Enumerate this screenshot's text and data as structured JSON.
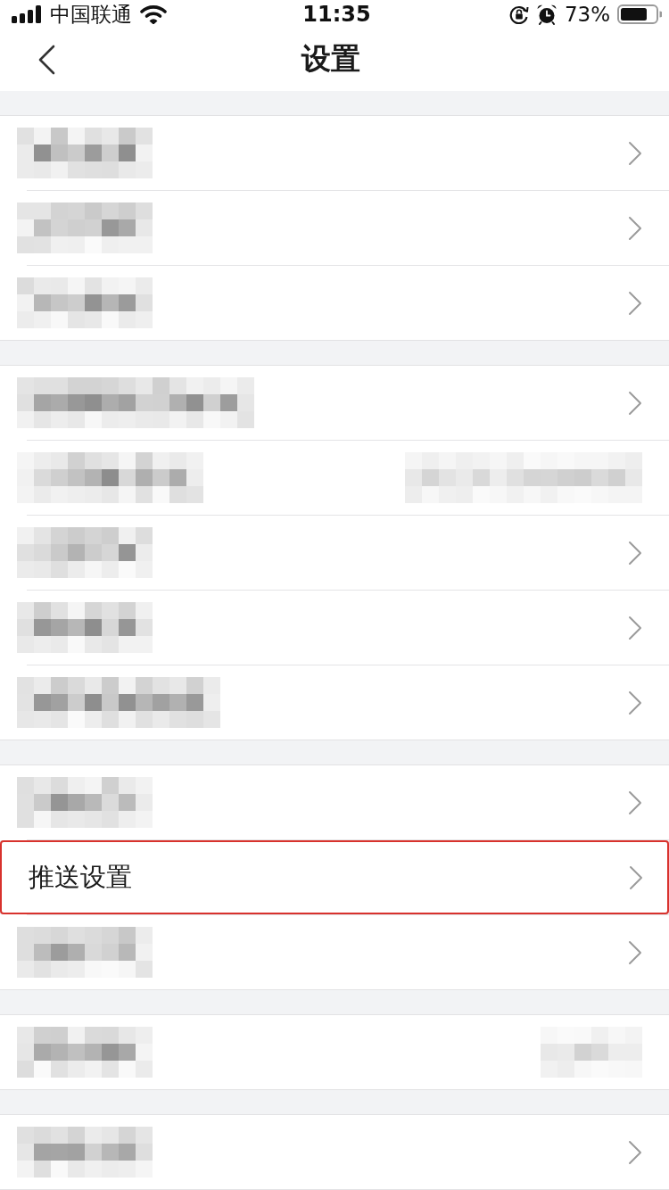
{
  "status_bar": {
    "carrier": "中国联通",
    "time": "11:35",
    "battery_percent": "73%"
  },
  "nav_bar": {
    "title": "设置"
  },
  "sections": [
    {
      "rows": [
        {
          "kind": "obscured",
          "obscured_value": false,
          "chevron": true,
          "highlighted": false
        },
        {
          "kind": "obscured",
          "obscured_value": false,
          "chevron": true,
          "highlighted": false
        },
        {
          "kind": "obscured",
          "obscured_value": false,
          "chevron": true,
          "highlighted": false
        }
      ]
    },
    {
      "rows": [
        {
          "kind": "obscured",
          "obscured_value": false,
          "chevron": true,
          "highlighted": false
        },
        {
          "kind": "obscured",
          "obscured_value": true,
          "chevron": false,
          "highlighted": false
        },
        {
          "kind": "obscured",
          "obscured_value": false,
          "chevron": true,
          "highlighted": false
        },
        {
          "kind": "obscured",
          "obscured_value": false,
          "chevron": true,
          "highlighted": false
        },
        {
          "kind": "obscured",
          "obscured_value": false,
          "chevron": true,
          "highlighted": false
        }
      ]
    },
    {
      "rows": [
        {
          "kind": "obscured",
          "obscured_value": false,
          "chevron": true,
          "highlighted": false
        },
        {
          "kind": "text",
          "label": "推送设置",
          "obscured_value": false,
          "chevron": true,
          "highlighted": true
        },
        {
          "kind": "obscured",
          "obscured_value": false,
          "chevron": true,
          "highlighted": false
        }
      ]
    },
    {
      "rows": [
        {
          "kind": "obscured",
          "obscured_value": true,
          "chevron": false,
          "highlighted": false
        }
      ]
    },
    {
      "rows": [
        {
          "kind": "obscured",
          "obscured_value": false,
          "chevron": true,
          "highlighted": false
        }
      ]
    }
  ]
}
